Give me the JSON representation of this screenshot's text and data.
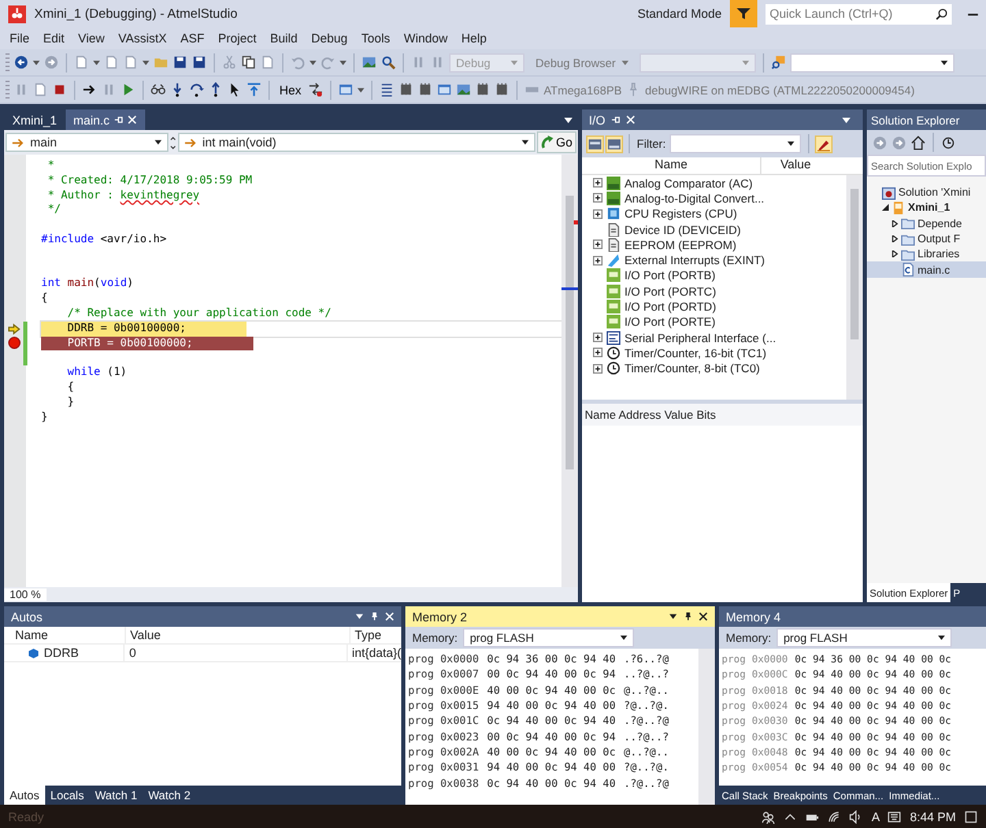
{
  "window": {
    "title": "Xmini_1 (Debugging) - AtmelStudio"
  },
  "title_bar": {
    "mode": "Standard Mode",
    "quick_launch": {
      "placeholder": "Quick Launch (Ctrl+Q)"
    }
  },
  "menu": [
    "File",
    "Edit",
    "View",
    "VAssistX",
    "ASF",
    "Project",
    "Build",
    "Debug",
    "Tools",
    "Window",
    "Help"
  ],
  "toolbar": {
    "config": "Debug",
    "browser": "Debug Browser",
    "hex": "Hex",
    "device": "ATmega168PB",
    "tool": "debugWIRE on mEDBG (ATML2222050200009454)"
  },
  "editor": {
    "tabs": [
      {
        "label": "Xmini_1",
        "selected": false
      },
      {
        "label": "main.c",
        "selected": true
      }
    ],
    "scope": "main",
    "member": "int main(void)",
    "go": "Go",
    "zoom": "100 %",
    "lines": [
      {
        "kind": "plain",
        "changed": false,
        "segs": [
          {
            "kind": "comment",
            "text": " *"
          }
        ]
      },
      {
        "kind": "plain",
        "changed": false,
        "segs": [
          {
            "kind": "comment",
            "text": " * Created: 4/17/2018 9:05:59 PM"
          }
        ]
      },
      {
        "kind": "plain",
        "changed": false,
        "segs": [
          {
            "kind": "comment",
            "text": " * Author : "
          },
          {
            "kind": "misspelled",
            "text": "kevinthegrey"
          }
        ]
      },
      {
        "kind": "plain",
        "changed": false,
        "segs": [
          {
            "kind": "comment",
            "text": " */"
          }
        ]
      },
      {
        "kind": "plain",
        "changed": false
      },
      {
        "kind": "plain",
        "changed": false,
        "segs": [
          {
            "kind": "preproc",
            "text": "#include"
          },
          {
            "kind": "plain",
            "text": " <avr/io.h>"
          }
        ]
      },
      {
        "kind": "plain",
        "changed": false
      },
      {
        "kind": "plain",
        "changed": false
      },
      {
        "kind": "plain",
        "changed": false,
        "segs": [
          {
            "kind": "keyword",
            "text": "int"
          },
          {
            "kind": "function",
            "text": " main"
          },
          {
            "kind": "plain",
            "text": "("
          },
          {
            "kind": "keyword",
            "text": "void"
          },
          {
            "kind": "plain",
            "text": ")"
          }
        ]
      },
      {
        "kind": "plain",
        "changed": false,
        "segs": [
          {
            "kind": "plain",
            "text": "{"
          }
        ]
      },
      {
        "kind": "plain",
        "changed": false,
        "segs": [
          {
            "kind": "comment",
            "text": "    /* Replace with your application code */"
          }
        ]
      },
      {
        "kind": "current",
        "changed": true,
        "segs": [
          {
            "kind": "plain",
            "text": "    DDRB = 0b00100000;"
          }
        ]
      },
      {
        "kind": "breakpoint",
        "changed": true,
        "segs": [
          {
            "kind": "plain",
            "text": "    PORTB = 0b00100000;"
          }
        ]
      },
      {
        "kind": "plain",
        "changed": true
      },
      {
        "kind": "plain",
        "changed": false,
        "segs": [
          {
            "kind": "keyword",
            "text": "    while"
          },
          {
            "kind": "plain",
            "text": " (1)"
          }
        ]
      },
      {
        "kind": "plain",
        "changed": false,
        "segs": [
          {
            "kind": "plain",
            "text": "    {"
          }
        ]
      },
      {
        "kind": "plain",
        "changed": false,
        "segs": [
          {
            "kind": "plain",
            "text": "    }"
          }
        ]
      },
      {
        "kind": "plain",
        "changed": false,
        "segs": [
          {
            "kind": "plain",
            "text": "}"
          }
        ]
      }
    ]
  },
  "io": {
    "title": "I/O",
    "filter_label": "Filter:",
    "columns": [
      "Name",
      "Value"
    ],
    "items": [
      {
        "label": "Analog Comparator (AC)",
        "kind": "adc",
        "expandable": true
      },
      {
        "label": "Analog-to-Digital Convert...",
        "kind": "adc",
        "expandable": true
      },
      {
        "label": "CPU Registers (CPU)",
        "kind": "cpu",
        "expandable": true
      },
      {
        "label": "Device ID (DEVICEID)",
        "kind": "doc",
        "expandable": false
      },
      {
        "label": "EEPROM (EEPROM)",
        "kind": "doc",
        "expandable": true
      },
      {
        "label": "External Interrupts (EXINT)",
        "kind": "interrupt",
        "expandable": true
      },
      {
        "label": "I/O Port (PORTB)",
        "kind": "port",
        "expandable": false
      },
      {
        "label": "I/O Port (PORTC)",
        "kind": "port",
        "expandable": false
      },
      {
        "label": "I/O Port (PORTD)",
        "kind": "port",
        "expandable": false
      },
      {
        "label": "I/O Port (PORTE)",
        "kind": "port",
        "expandable": false
      },
      {
        "label": "Serial Peripheral Interface (...",
        "kind": "spi",
        "expandable": true
      },
      {
        "label": "Timer/Counter, 16-bit (TC1)",
        "kind": "timer",
        "expandable": true
      },
      {
        "label": "Timer/Counter, 8-bit (TC0)",
        "kind": "timer",
        "expandable": true
      }
    ],
    "detail_header": "Name Address Value Bits"
  },
  "solution": {
    "title": "Solution Explorer",
    "search": {
      "placeholder": "Search Solution Explo"
    },
    "tree": [
      {
        "label": "Solution 'Xmini",
        "kind": "solution",
        "selected": false,
        "children": [
          {
            "label": "Xmini_1",
            "kind": "project",
            "selected": false,
            "expanded": true,
            "children": [
              {
                "label": "Depende",
                "kind": "folder",
                "selected": false,
                "expanded": false
              },
              {
                "label": "Output F",
                "kind": "folder",
                "selected": false,
                "expanded": false
              },
              {
                "label": "Libraries",
                "kind": "folder",
                "selected": false,
                "expanded": false
              },
              {
                "label": "main.c",
                "kind": "file",
                "selected": true
              }
            ]
          }
        ]
      }
    ],
    "tabs": [
      {
        "label": "Solution Explorer",
        "selected": true
      },
      {
        "label": "P",
        "selected": false
      }
    ]
  },
  "autos": {
    "title": "Autos",
    "active": false,
    "columns": [
      "Name",
      "Value",
      "Type"
    ],
    "rows": [
      {
        "name": "DDRB",
        "value": "0",
        "type": "int{data}("
      }
    ],
    "tabs": [
      {
        "label": "Autos",
        "selected": true
      },
      {
        "label": "Locals",
        "selected": false
      },
      {
        "label": "Watch 1",
        "selected": false
      },
      {
        "label": "Watch 2",
        "selected": false
      }
    ]
  },
  "memory2": {
    "title": "Memory 2",
    "active": true,
    "memory_label": "Memory:",
    "memory": "prog FLASH",
    "rows": [
      {
        "address": "prog 0x0000",
        "bytes": "0c 94 36 00 0c 94 40",
        "ascii": ".?6..?@"
      },
      {
        "address": "prog 0x0007",
        "bytes": "00 0c 94 40 00 0c 94",
        "ascii": "..?@..?"
      },
      {
        "address": "prog 0x000E",
        "bytes": "40 00 0c 94 40 00 0c",
        "ascii": "@..?@.."
      },
      {
        "address": "prog 0x0015",
        "bytes": "94 40 00 0c 94 40 00",
        "ascii": "?@..?@."
      },
      {
        "address": "prog 0x001C",
        "bytes": "0c 94 40 00 0c 94 40",
        "ascii": ".?@..?@"
      },
      {
        "address": "prog 0x0023",
        "bytes": "00 0c 94 40 00 0c 94",
        "ascii": "..?@..?"
      },
      {
        "address": "prog 0x002A",
        "bytes": "40 00 0c 94 40 00 0c",
        "ascii": "@..?@.."
      },
      {
        "address": "prog 0x0031",
        "bytes": "94 40 00 0c 94 40 00",
        "ascii": "?@..?@."
      },
      {
        "address": "prog 0x0038",
        "bytes": "0c 94 40 00 0c 94 40",
        "ascii": ".?@..?@"
      }
    ]
  },
  "memory4": {
    "title": "Memory 4",
    "active": false,
    "memory_label": "Memory:",
    "memory": "prog FLASH",
    "rows": [
      {
        "address": "prog 0x0000",
        "bytes": "0c 94 36 00 0c 94 40 00 0c"
      },
      {
        "address": "prog 0x000C",
        "bytes": "0c 94 40 00 0c 94 40 00 0c"
      },
      {
        "address": "prog 0x0018",
        "bytes": "0c 94 40 00 0c 94 40 00 0c"
      },
      {
        "address": "prog 0x0024",
        "bytes": "0c 94 40 00 0c 94 40 00 0c"
      },
      {
        "address": "prog 0x0030",
        "bytes": "0c 94 40 00 0c 94 40 00 0c"
      },
      {
        "address": "prog 0x003C",
        "bytes": "0c 94 40 00 0c 94 40 00 0c"
      },
      {
        "address": "prog 0x0048",
        "bytes": "0c 94 40 00 0c 94 40 00 0c"
      },
      {
        "address": "prog 0x0054",
        "bytes": "0c 94 40 00 0c 94 40 00 0c"
      }
    ],
    "tabs": [
      {
        "label": "Call Stack",
        "selected": false
      },
      {
        "label": "Breakpoints",
        "selected": false
      },
      {
        "label": "Comman...",
        "selected": false
      },
      {
        "label": "Immediat...",
        "selected": false
      }
    ]
  },
  "status_bar": {
    "text": "Ready"
  },
  "taskbar": {
    "ime": "A",
    "time": "8:44 PM"
  }
}
